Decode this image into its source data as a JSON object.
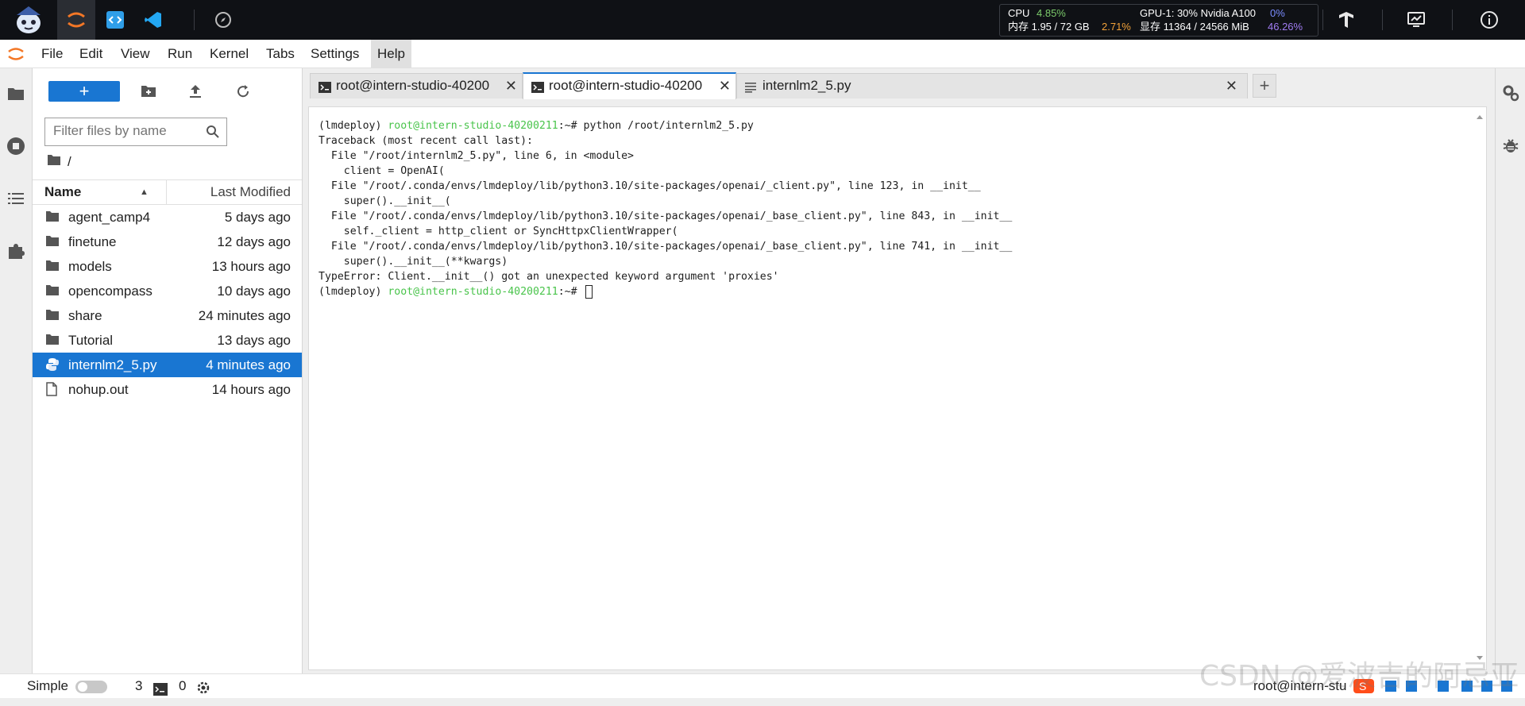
{
  "menubar": {
    "items": [
      "File",
      "Edit",
      "View",
      "Run",
      "Kernel",
      "Tabs",
      "Settings",
      "Help"
    ],
    "active": "Help"
  },
  "system": {
    "cpu_label": "CPU",
    "cpu_value": "4.85%",
    "mem_label": "内存 1.95 / 72 GB",
    "mem_value": "2.71%",
    "gpu_label": "GPU-1: 30% Nvidia A100",
    "gpu_value": "0%",
    "vram_label": "显存 11364 / 24566 MiB",
    "vram_value": "46.26%"
  },
  "filebrowser": {
    "new_label": "+",
    "filter_placeholder": "Filter files by name",
    "path": "/",
    "col_name": "Name",
    "col_modified": "Last Modified",
    "files": [
      {
        "name": "agent_camp4",
        "modified": "5 days ago",
        "type": "folder"
      },
      {
        "name": "finetune",
        "modified": "12 days ago",
        "type": "folder"
      },
      {
        "name": "models",
        "modified": "13 hours ago",
        "type": "folder"
      },
      {
        "name": "opencompass",
        "modified": "10 days ago",
        "type": "folder"
      },
      {
        "name": "share",
        "modified": "24 minutes ago",
        "type": "folder"
      },
      {
        "name": "Tutorial",
        "modified": "13 days ago",
        "type": "folder"
      },
      {
        "name": "internlm2_5.py",
        "modified": "4 minutes ago",
        "type": "python",
        "selected": true
      },
      {
        "name": "nohup.out",
        "modified": "14 hours ago",
        "type": "file"
      }
    ]
  },
  "tabs": [
    {
      "label": "root@intern-studio-40200",
      "kind": "terminal",
      "active": false
    },
    {
      "label": "root@intern-studio-40200",
      "kind": "terminal",
      "active": true
    },
    {
      "label": "internlm2_5.py",
      "kind": "text",
      "active": false
    }
  ],
  "terminal": {
    "env": "(lmdeploy)",
    "user_host": "root@intern-studio-40200211",
    "prompt_suffix": ":~# ",
    "command": "python /root/internlm2_5.py",
    "output": [
      "Traceback (most recent call last):",
      "  File \"/root/internlm2_5.py\", line 6, in <module>",
      "    client = OpenAI(",
      "  File \"/root/.conda/envs/lmdeploy/lib/python3.10/site-packages/openai/_client.py\", line 123, in __init__",
      "    super().__init__(",
      "  File \"/root/.conda/envs/lmdeploy/lib/python3.10/site-packages/openai/_base_client.py\", line 843, in __init__",
      "    self._client = http_client or SyncHttpxClientWrapper(",
      "  File \"/root/.conda/envs/lmdeploy/lib/python3.10/site-packages/openai/_base_client.py\", line 741, in __init__",
      "    super().__init__(**kwargs)",
      "TypeError: Client.__init__() got an unexpected keyword argument 'proxies'"
    ]
  },
  "statusbar": {
    "mode_label": "Simple",
    "kernel_count": "3",
    "terminal_count": "0",
    "right_text": "root@intern-stu"
  },
  "watermark": "CSDN @爱波吉的阿忌亚",
  "colors": {
    "accent": "#1976d2",
    "prompt": "#49c44b",
    "topbar": "#0f1115"
  }
}
